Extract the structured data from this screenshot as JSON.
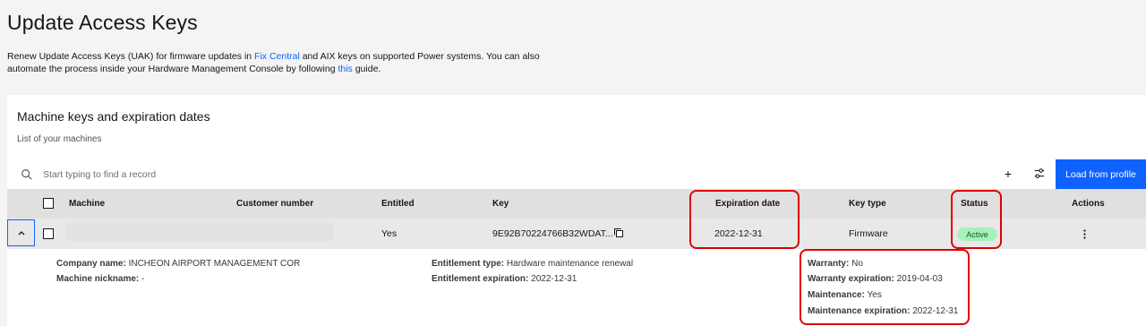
{
  "page": {
    "title": "Update Access Keys",
    "intro": {
      "part1": "Renew Update Access Keys (UAK) for firmware updates in ",
      "link1": "Fix Central",
      "part2": " and AIX keys on supported Power systems. You can also automate the process inside your Hardware Management Console by following ",
      "link2": "this",
      "part3": " guide."
    }
  },
  "card": {
    "title": "Machine keys and expiration dates",
    "subtitle": "List of your machines"
  },
  "toolbar": {
    "search_placeholder": "Start typing to find a record",
    "add_label": "+",
    "load_label": "Load from profile"
  },
  "table": {
    "headers": {
      "machine": "Machine",
      "customer_number": "Customer number",
      "entitled": "Entitled",
      "key": "Key",
      "expiration_date": "Expiration date",
      "key_type": "Key type",
      "status": "Status",
      "actions": "Actions"
    },
    "rows": [
      {
        "entitled": "Yes",
        "key": "9E92B70224766B32WDAT...",
        "expiration_date": "2022-12-31",
        "key_type": "Firmware",
        "status": "Active"
      }
    ]
  },
  "details": {
    "company_name_label": "Company name:",
    "company_name": "INCHEON AIRPORT MANAGEMENT COR",
    "machine_nickname_label": "Machine nickname:",
    "machine_nickname": "-",
    "entitlement_type_label": "Entitlement type:",
    "entitlement_type": "Hardware maintenance renewal",
    "entitlement_expiration_label": "Entitlement expiration:",
    "entitlement_expiration": "2022-12-31",
    "warranty_label": "Warranty:",
    "warranty": "No",
    "warranty_expiration_label": "Warranty expiration:",
    "warranty_expiration": "2019-04-03",
    "maintenance_label": "Maintenance:",
    "maintenance": "Yes",
    "maintenance_expiration_label": "Maintenance expiration:",
    "maintenance_expiration": "2022-12-31"
  },
  "colors": {
    "accent": "#0f62fe",
    "highlight": "#e00000",
    "status_bg": "#a7f0ba",
    "status_text": "#0e6027"
  },
  "icons": [
    "search-icon",
    "add-icon",
    "settings-adjust-icon",
    "chevron-up-icon",
    "copy-icon",
    "overflow-menu-icon"
  ]
}
